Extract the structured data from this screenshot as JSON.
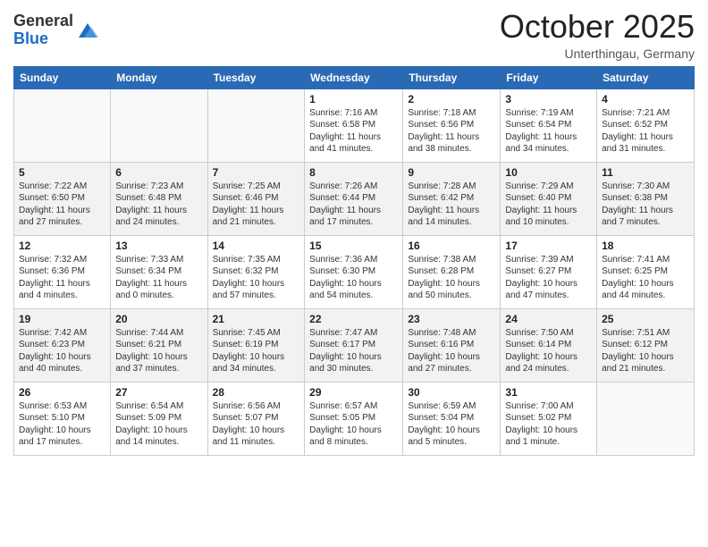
{
  "header": {
    "logo_general": "General",
    "logo_blue": "Blue",
    "title": "October 2025",
    "location": "Unterthingau, Germany"
  },
  "days_of_week": [
    "Sunday",
    "Monday",
    "Tuesday",
    "Wednesday",
    "Thursday",
    "Friday",
    "Saturday"
  ],
  "weeks": [
    [
      {
        "day": "",
        "info": ""
      },
      {
        "day": "",
        "info": ""
      },
      {
        "day": "",
        "info": ""
      },
      {
        "day": "1",
        "info": "Sunrise: 7:16 AM\nSunset: 6:58 PM\nDaylight: 11 hours and 41 minutes."
      },
      {
        "day": "2",
        "info": "Sunrise: 7:18 AM\nSunset: 6:56 PM\nDaylight: 11 hours and 38 minutes."
      },
      {
        "day": "3",
        "info": "Sunrise: 7:19 AM\nSunset: 6:54 PM\nDaylight: 11 hours and 34 minutes."
      },
      {
        "day": "4",
        "info": "Sunrise: 7:21 AM\nSunset: 6:52 PM\nDaylight: 11 hours and 31 minutes."
      }
    ],
    [
      {
        "day": "5",
        "info": "Sunrise: 7:22 AM\nSunset: 6:50 PM\nDaylight: 11 hours and 27 minutes."
      },
      {
        "day": "6",
        "info": "Sunrise: 7:23 AM\nSunset: 6:48 PM\nDaylight: 11 hours and 24 minutes."
      },
      {
        "day": "7",
        "info": "Sunrise: 7:25 AM\nSunset: 6:46 PM\nDaylight: 11 hours and 21 minutes."
      },
      {
        "day": "8",
        "info": "Sunrise: 7:26 AM\nSunset: 6:44 PM\nDaylight: 11 hours and 17 minutes."
      },
      {
        "day": "9",
        "info": "Sunrise: 7:28 AM\nSunset: 6:42 PM\nDaylight: 11 hours and 14 minutes."
      },
      {
        "day": "10",
        "info": "Sunrise: 7:29 AM\nSunset: 6:40 PM\nDaylight: 11 hours and 10 minutes."
      },
      {
        "day": "11",
        "info": "Sunrise: 7:30 AM\nSunset: 6:38 PM\nDaylight: 11 hours and 7 minutes."
      }
    ],
    [
      {
        "day": "12",
        "info": "Sunrise: 7:32 AM\nSunset: 6:36 PM\nDaylight: 11 hours and 4 minutes."
      },
      {
        "day": "13",
        "info": "Sunrise: 7:33 AM\nSunset: 6:34 PM\nDaylight: 11 hours and 0 minutes."
      },
      {
        "day": "14",
        "info": "Sunrise: 7:35 AM\nSunset: 6:32 PM\nDaylight: 10 hours and 57 minutes."
      },
      {
        "day": "15",
        "info": "Sunrise: 7:36 AM\nSunset: 6:30 PM\nDaylight: 10 hours and 54 minutes."
      },
      {
        "day": "16",
        "info": "Sunrise: 7:38 AM\nSunset: 6:28 PM\nDaylight: 10 hours and 50 minutes."
      },
      {
        "day": "17",
        "info": "Sunrise: 7:39 AM\nSunset: 6:27 PM\nDaylight: 10 hours and 47 minutes."
      },
      {
        "day": "18",
        "info": "Sunrise: 7:41 AM\nSunset: 6:25 PM\nDaylight: 10 hours and 44 minutes."
      }
    ],
    [
      {
        "day": "19",
        "info": "Sunrise: 7:42 AM\nSunset: 6:23 PM\nDaylight: 10 hours and 40 minutes."
      },
      {
        "day": "20",
        "info": "Sunrise: 7:44 AM\nSunset: 6:21 PM\nDaylight: 10 hours and 37 minutes."
      },
      {
        "day": "21",
        "info": "Sunrise: 7:45 AM\nSunset: 6:19 PM\nDaylight: 10 hours and 34 minutes."
      },
      {
        "day": "22",
        "info": "Sunrise: 7:47 AM\nSunset: 6:17 PM\nDaylight: 10 hours and 30 minutes."
      },
      {
        "day": "23",
        "info": "Sunrise: 7:48 AM\nSunset: 6:16 PM\nDaylight: 10 hours and 27 minutes."
      },
      {
        "day": "24",
        "info": "Sunrise: 7:50 AM\nSunset: 6:14 PM\nDaylight: 10 hours and 24 minutes."
      },
      {
        "day": "25",
        "info": "Sunrise: 7:51 AM\nSunset: 6:12 PM\nDaylight: 10 hours and 21 minutes."
      }
    ],
    [
      {
        "day": "26",
        "info": "Sunrise: 6:53 AM\nSunset: 5:10 PM\nDaylight: 10 hours and 17 minutes."
      },
      {
        "day": "27",
        "info": "Sunrise: 6:54 AM\nSunset: 5:09 PM\nDaylight: 10 hours and 14 minutes."
      },
      {
        "day": "28",
        "info": "Sunrise: 6:56 AM\nSunset: 5:07 PM\nDaylight: 10 hours and 11 minutes."
      },
      {
        "day": "29",
        "info": "Sunrise: 6:57 AM\nSunset: 5:05 PM\nDaylight: 10 hours and 8 minutes."
      },
      {
        "day": "30",
        "info": "Sunrise: 6:59 AM\nSunset: 5:04 PM\nDaylight: 10 hours and 5 minutes."
      },
      {
        "day": "31",
        "info": "Sunrise: 7:00 AM\nSunset: 5:02 PM\nDaylight: 10 hours and 1 minute."
      },
      {
        "day": "",
        "info": ""
      }
    ]
  ]
}
